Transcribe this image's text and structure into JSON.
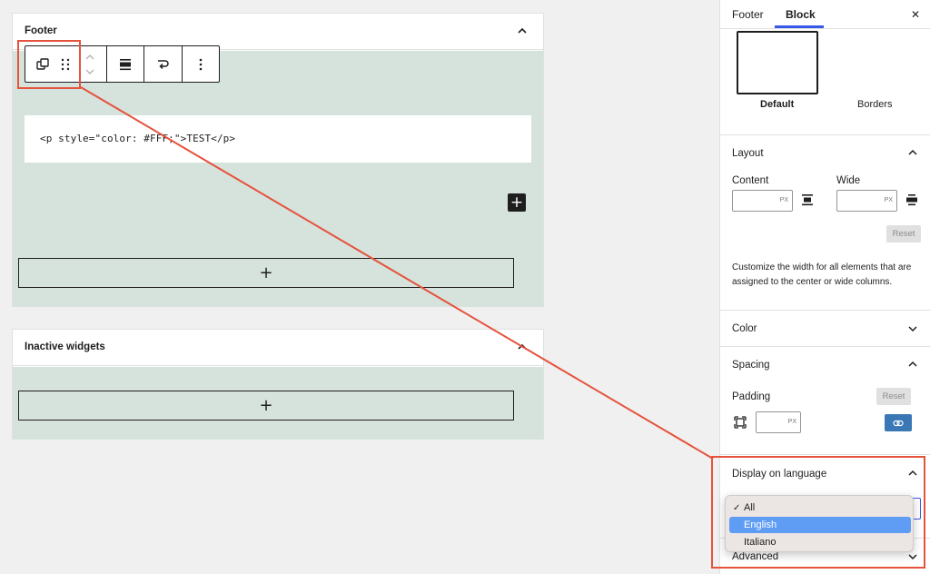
{
  "widget_areas": {
    "footer": {
      "title": "Footer"
    },
    "inactive": {
      "title": "Inactive widgets"
    }
  },
  "code_block": {
    "content": "<p style=\"color: #FFF;\">TEST</p>"
  },
  "appender_symbol": "+",
  "sidebar": {
    "tabs": [
      {
        "label": "Footer",
        "active": false
      },
      {
        "label": "Block",
        "active": true
      }
    ],
    "close_symbol": "✕",
    "styles": {
      "default_label": "Default",
      "borders_label": "Borders"
    },
    "layout": {
      "title": "Layout",
      "content_label": "Content",
      "wide_label": "Wide",
      "unit": "PX",
      "reset_label": "Reset",
      "description": "Customize the width for all elements that are assigned to the center or wide columns."
    },
    "color": {
      "title": "Color"
    },
    "spacing": {
      "title": "Spacing",
      "padding_label": "Padding",
      "reset_label": "Reset",
      "unit": "PX"
    },
    "display_on_language": {
      "title": "Display on language",
      "options": [
        "All",
        "English",
        "Italiano"
      ],
      "checked": "All",
      "highlighted": "English",
      "check_mark": "✓"
    },
    "advanced": {
      "title": "Advanced"
    }
  },
  "colors": {
    "accent": "#3858e9",
    "annotation": "#e5533d",
    "area_body": "#d6e3dd",
    "dropdown_highlight": "#5f9df5",
    "link_button": "#3a78b5"
  },
  "icons": {
    "toolbar": [
      "block-type-icon",
      "drag-handle-icon",
      "move-up-icon",
      "move-down-icon",
      "align-icon",
      "transform-icon",
      "more-options-icon"
    ]
  }
}
